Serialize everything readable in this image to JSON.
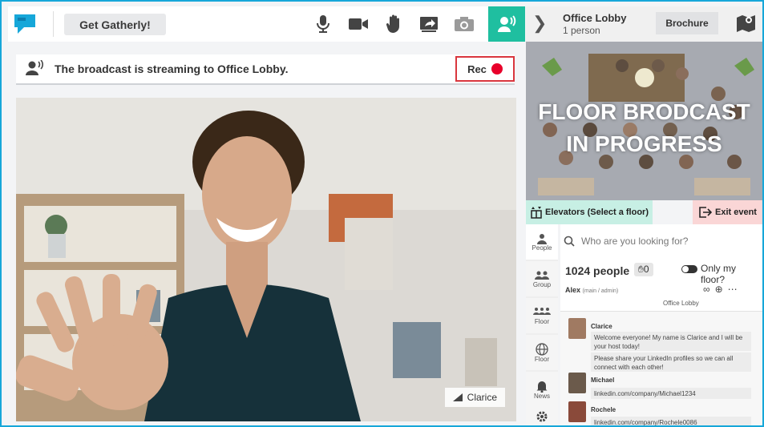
{
  "toolbar": {
    "get_button": "Get Gatherly!",
    "icons": [
      "microphone-icon",
      "video-camera-icon",
      "raise-hand-icon",
      "share-screen-icon",
      "camera-icon",
      "broadcast-icon"
    ],
    "accent": "#1fbfa0"
  },
  "broadcast": {
    "message": "The broadcast is streaming to Office Lobby.",
    "rec_label": "Rec",
    "rec_color": "#e8002a"
  },
  "video": {
    "name_tag": "Clarice"
  },
  "right_panel": {
    "title": "Office Lobby",
    "subtitle": "1 person",
    "brochure": "Brochure",
    "floor_overlay": [
      "FLOOR BRODCAST",
      "IN PROGRESS"
    ],
    "elevators": "Elevators (Select a floor)",
    "exit": "Exit event"
  },
  "nav": {
    "items": [
      {
        "label": "People",
        "icon": "person-icon"
      },
      {
        "label": "Group",
        "icon": "group-icon"
      },
      {
        "label": "Floor",
        "icon": "floor-icon"
      },
      {
        "label": "Floor",
        "icon": "globe-icon"
      },
      {
        "label": "News",
        "icon": "bell-icon"
      },
      {
        "label": "",
        "icon": "gear-icon"
      }
    ]
  },
  "people": {
    "search_placeholder": "Who are you looking for?",
    "count": "1024 people",
    "hand_count": "0",
    "only_floor": "Only my floor?",
    "host_name": "Alex",
    "host_role": "(main / admin)",
    "location": "Office Lobby"
  },
  "chat": {
    "messages": [
      {
        "name": "Clarice",
        "lines": [
          "Welcome everyone! My name is Clarice and I will be your host today!",
          "Please share your LinkedIn profiles so we can all connect with each other!"
        ]
      },
      {
        "name": "Michael",
        "lines": [
          "linkedin.com/company/Michael1234"
        ]
      },
      {
        "name": "Rochele",
        "lines": [
          "linkedin.com/company/Rochele0086"
        ]
      }
    ]
  }
}
